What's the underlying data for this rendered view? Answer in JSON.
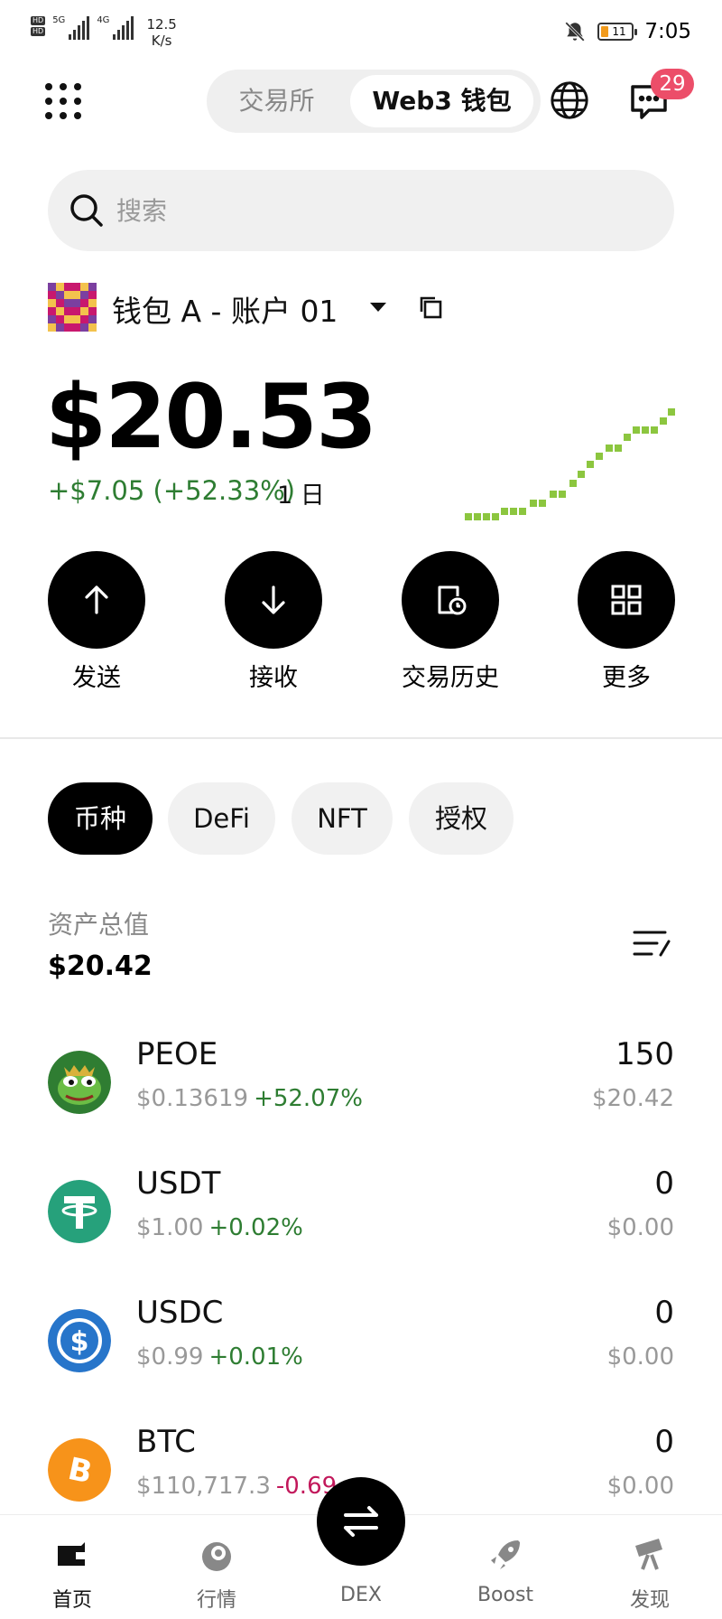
{
  "status_bar": {
    "hd1": "HD",
    "hd2": "HD",
    "net1": "5G",
    "net2": "4G",
    "speed_value": "12.5",
    "speed_unit": "K/s",
    "battery_level": "11",
    "time": "7:05"
  },
  "header": {
    "tabs": [
      "交易所",
      "Web3 钱包"
    ],
    "active_tab": "Web3 钱包",
    "notification_count": "29"
  },
  "search": {
    "placeholder": "搜索",
    "value": ""
  },
  "wallet": {
    "name": "钱包 A - 账户 01",
    "balance": "$20.53",
    "change": "+$7.05 (+52.33%)",
    "change_period": "1 日",
    "sparkline_color": "#8cc63f"
  },
  "actions": [
    {
      "label": "发送",
      "icon": "arrow-up-icon"
    },
    {
      "label": "接收",
      "icon": "arrow-down-icon"
    },
    {
      "label": "交易历史",
      "icon": "history-icon"
    },
    {
      "label": "更多",
      "icon": "grid-apps-icon"
    }
  ],
  "filters": {
    "items": [
      "币种",
      "DeFi",
      "NFT",
      "授权"
    ],
    "active": "币种"
  },
  "assets": {
    "total_label": "资产总值",
    "total_value": "$20.42"
  },
  "tokens": [
    {
      "symbol": "PEOE",
      "price": "$0.13619",
      "change": "+52.07%",
      "quantity": "150",
      "value": "$20.42",
      "icon": "pepe-frog-icon"
    },
    {
      "symbol": "USDT",
      "price": "$1.00",
      "change": "+0.02%",
      "quantity": "0",
      "value": "$0.00",
      "icon": "tether-icon"
    },
    {
      "symbol": "USDC",
      "price": "$0.99",
      "change": "+0.01%",
      "quantity": "0",
      "value": "$0.00",
      "icon": "usdc-icon"
    },
    {
      "symbol": "BTC",
      "price": "$110,717.3",
      "change": "-0.69",
      "quantity": "0",
      "value": "$0.00",
      "icon": "bitcoin-icon"
    }
  ],
  "bottom_nav": {
    "items": [
      "首页",
      "行情",
      "DEX",
      "Boost",
      "发现"
    ],
    "active": "首页"
  },
  "colors": {
    "positive": "#2e7d32",
    "negative": "#c2185b",
    "badge": "#ec4e69",
    "tether": "#26a17b",
    "usdc": "#2775ca",
    "bitcoin": "#f7931a"
  }
}
